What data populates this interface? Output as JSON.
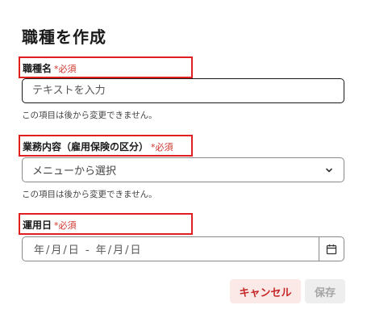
{
  "form": {
    "title": "職種を作成",
    "required_mark": "*必須",
    "job_name": {
      "label": "職種名",
      "placeholder": "テキストを入力",
      "value": "",
      "help": "この項目は後から変更できません。"
    },
    "work_content": {
      "label": "業務内容（雇用保険の区分）",
      "selected": "メニューから選択",
      "help": "この項目は後から変更できません。"
    },
    "start_date": {
      "label": "運用日",
      "placeholder": "年/月/日 - 年/月/日"
    }
  },
  "buttons": {
    "cancel": "キャンセル",
    "save": "保存"
  },
  "colors": {
    "highlight": "#e02020",
    "required": "#d0342c",
    "cancel_bg": "#fbe9e7",
    "cancel_text": "#c62828",
    "save_bg": "#eeeeee",
    "save_text": "#a5a5a5"
  },
  "icons": {
    "dropdown": "chevron-down-icon",
    "date_picker": "calendar-icon"
  }
}
